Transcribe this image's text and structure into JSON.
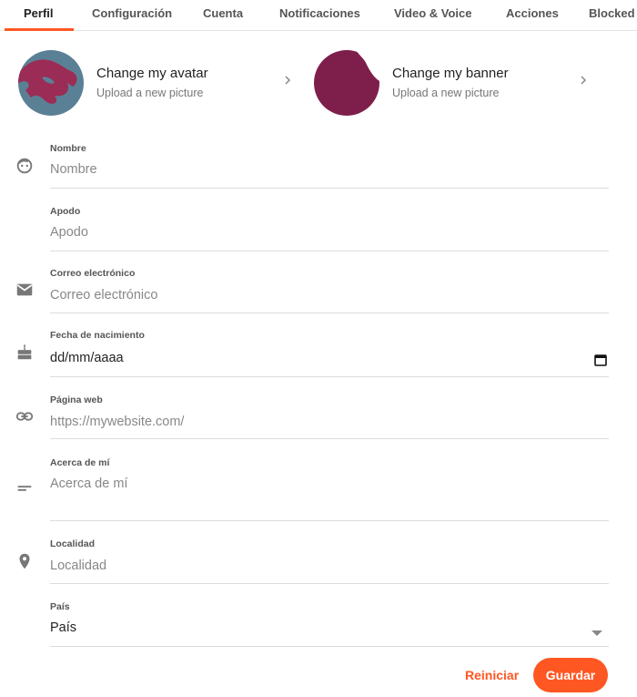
{
  "tabs": [
    {
      "label": "Perfil",
      "active": true
    },
    {
      "label": "Configuración"
    },
    {
      "label": "Cuenta"
    },
    {
      "label": "Notificaciones"
    },
    {
      "label": "Video & Voice"
    },
    {
      "label": "Acciones"
    },
    {
      "label": "Blocked"
    }
  ],
  "avatar_card": {
    "title": "Change my avatar",
    "subtitle": "Upload a new picture",
    "icon": "chevron-right-icon"
  },
  "banner_card": {
    "title": "Change my banner",
    "subtitle": "Upload a new picture",
    "icon": "chevron-right-icon"
  },
  "fields": {
    "nombre": {
      "label": "Nombre",
      "placeholder": "Nombre",
      "icon": "face-icon"
    },
    "apodo": {
      "label": "Apodo",
      "placeholder": "Apodo"
    },
    "correo": {
      "label": "Correo electrónico",
      "placeholder": "Correo electrónico",
      "icon": "mail-icon"
    },
    "fecha": {
      "label": "Fecha de nacimiento",
      "value": "dd/mm/aaaa",
      "icon": "cake-icon"
    },
    "web": {
      "label": "Página web",
      "placeholder": "https://mywebsite.com/",
      "icon": "link-icon"
    },
    "acerca": {
      "label": "Acerca de mí",
      "placeholder": "Acerca de mí",
      "icon": "notes-icon"
    },
    "localidad": {
      "label": "Localidad",
      "placeholder": "Localidad",
      "icon": "location-pin-icon"
    },
    "pais": {
      "label": "País",
      "value": "País"
    }
  },
  "buttons": {
    "reset": "Reiniciar",
    "save": "Guardar"
  },
  "colors": {
    "accent": "#ff5722",
    "avatar_bg": "#5a8096",
    "avatar_shape": "#9b2c55",
    "banner": "#7e1e4b"
  }
}
